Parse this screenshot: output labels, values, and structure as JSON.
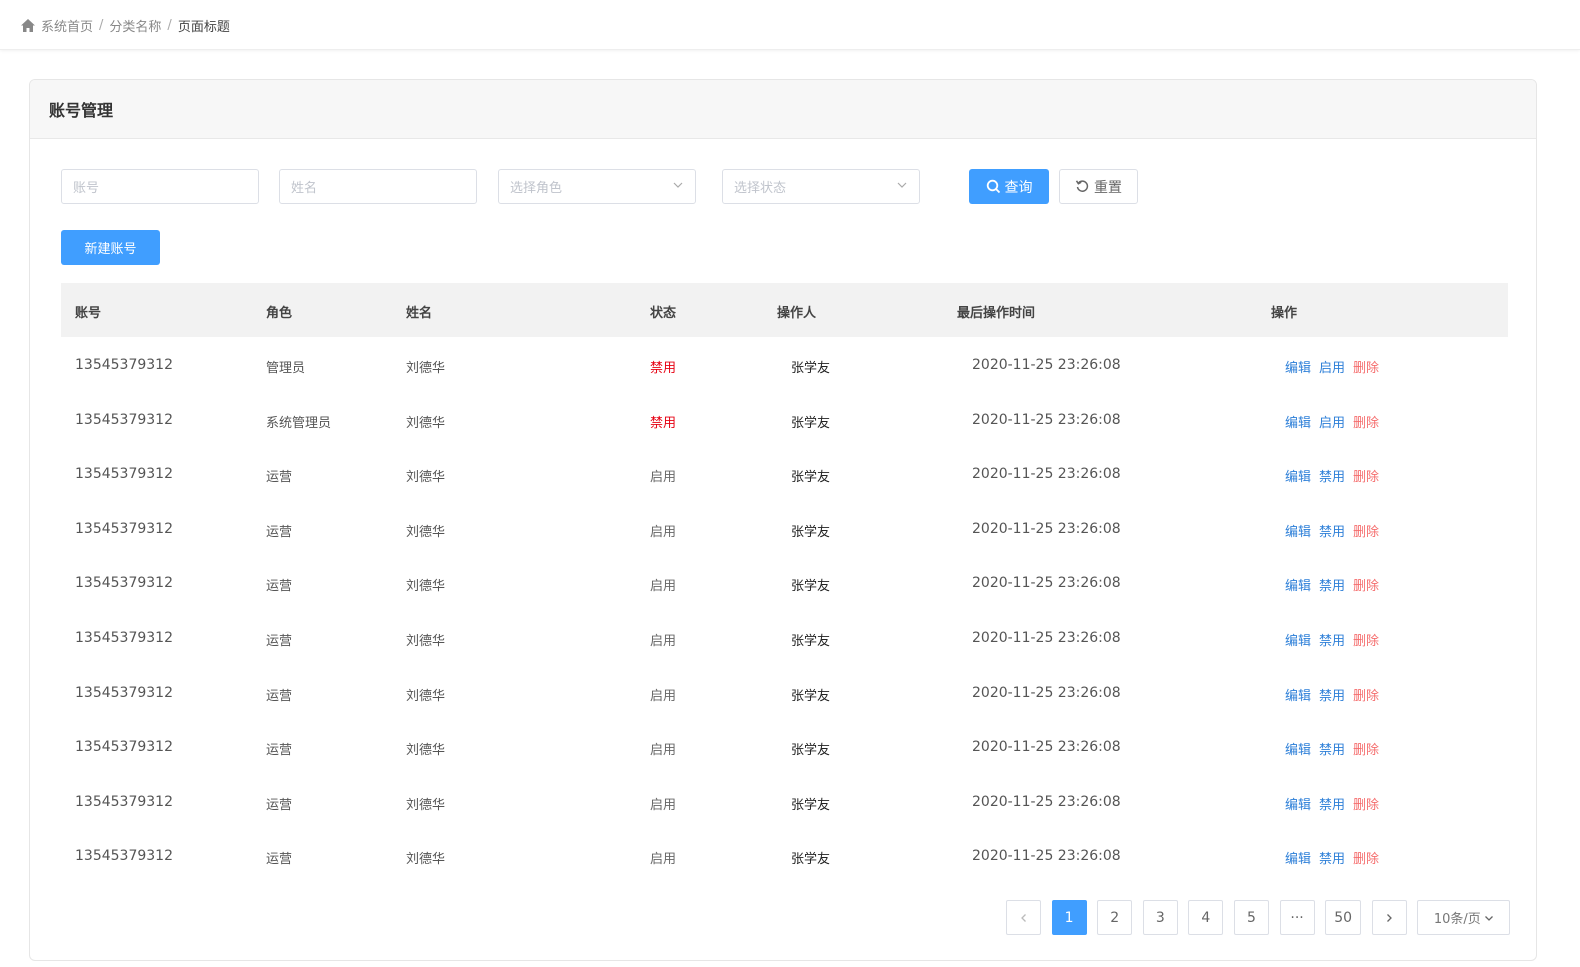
{
  "breadcrumb": {
    "items": [
      "系统首页",
      "分类名称",
      "页面标题"
    ],
    "separator": "/"
  },
  "card": {
    "title": "账号管理"
  },
  "filters": {
    "account_placeholder": "账号",
    "name_placeholder": "姓名",
    "role_placeholder": "选择角色",
    "status_placeholder": "选择状态"
  },
  "buttons": {
    "search": "查询",
    "reset": "重置",
    "new_account": "新建账号"
  },
  "table": {
    "headers": [
      "账号",
      "角色",
      "姓名",
      "状态",
      "操作人",
      "最后操作时间",
      "操作"
    ],
    "action_labels": {
      "edit": "编辑",
      "delete": "删除"
    },
    "rows": [
      {
        "account": "13545379312",
        "role": "管理员",
        "name": "刘德华",
        "status": "禁用",
        "operator": "张学友",
        "time": "2020-11-25 23:26:08",
        "toggle": "启用"
      },
      {
        "account": "13545379312",
        "role": "系统管理员",
        "name": "刘德华",
        "status": "禁用",
        "operator": "张学友",
        "time": "2020-11-25 23:26:08",
        "toggle": "启用"
      },
      {
        "account": "13545379312",
        "role": "运营",
        "name": "刘德华",
        "status": "启用",
        "operator": "张学友",
        "time": "2020-11-25 23:26:08",
        "toggle": "禁用"
      },
      {
        "account": "13545379312",
        "role": "运营",
        "name": "刘德华",
        "status": "启用",
        "operator": "张学友",
        "time": "2020-11-25 23:26:08",
        "toggle": "禁用"
      },
      {
        "account": "13545379312",
        "role": "运营",
        "name": "刘德华",
        "status": "启用",
        "operator": "张学友",
        "time": "2020-11-25 23:26:08",
        "toggle": "禁用"
      },
      {
        "account": "13545379312",
        "role": "运营",
        "name": "刘德华",
        "status": "启用",
        "operator": "张学友",
        "time": "2020-11-25 23:26:08",
        "toggle": "禁用"
      },
      {
        "account": "13545379312",
        "role": "运营",
        "name": "刘德华",
        "status": "启用",
        "operator": "张学友",
        "time": "2020-11-25 23:26:08",
        "toggle": "禁用"
      },
      {
        "account": "13545379312",
        "role": "运营",
        "name": "刘德华",
        "status": "启用",
        "operator": "张学友",
        "time": "2020-11-25 23:26:08",
        "toggle": "禁用"
      },
      {
        "account": "13545379312",
        "role": "运营",
        "name": "刘德华",
        "status": "启用",
        "operator": "张学友",
        "time": "2020-11-25 23:26:08",
        "toggle": "禁用"
      },
      {
        "account": "13545379312",
        "role": "运营",
        "name": "刘德华",
        "status": "启用",
        "operator": "张学友",
        "time": "2020-11-25 23:26:08",
        "toggle": "禁用"
      }
    ]
  },
  "pagination": {
    "pages": [
      "1",
      "2",
      "3",
      "4",
      "5"
    ],
    "ellipsis": "···",
    "last": "50",
    "current": "1",
    "page_size": "10条/页"
  },
  "colors": {
    "primary": "#409eff",
    "link": "#2d7fd8",
    "danger": "#f56c6c",
    "disabled_status": "#e60012"
  }
}
